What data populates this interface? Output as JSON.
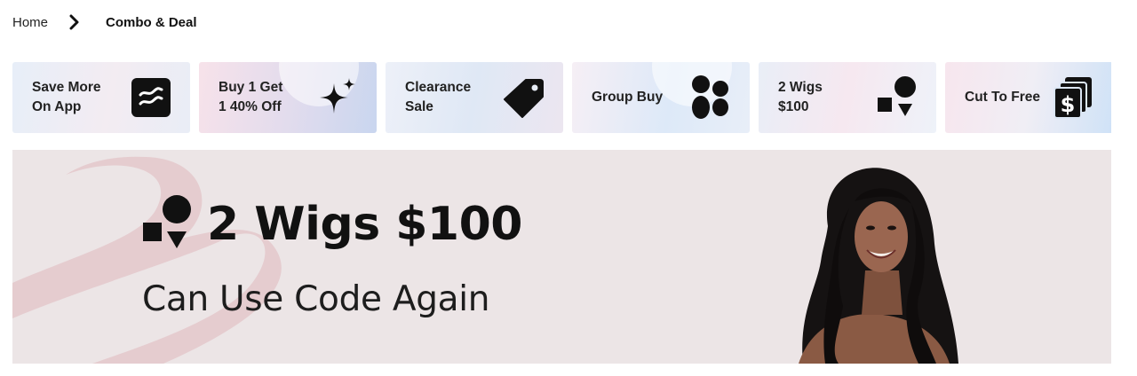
{
  "breadcrumb": {
    "home_label": "Home",
    "separator_icon": "chevron-right-icon",
    "current_label": "Combo & Deal"
  },
  "promo_cards": [
    {
      "label": "Save More\nOn App",
      "icon": "app-logo-icon"
    },
    {
      "label": "Buy 1 Get\n1 40% Off",
      "icon": "sparkle-icon"
    },
    {
      "label": "Clearance\nSale",
      "icon": "price-tag-icon"
    },
    {
      "label": "Group Buy",
      "icon": "group-dots-icon"
    },
    {
      "label": "2 Wigs\n$100",
      "icon": "shapes-icon"
    },
    {
      "label": "Cut To Free",
      "icon": "dollar-cards-icon"
    }
  ],
  "banner": {
    "title": "2 Wigs $100",
    "subtitle": "Can Use Code Again",
    "icon": "shapes-icon",
    "image": "model-with-wavy-black-hair"
  },
  "colors": {
    "banner_bg": "#ece5e6",
    "deco_pink": "#e3c3c7",
    "icon_black": "#111111"
  }
}
